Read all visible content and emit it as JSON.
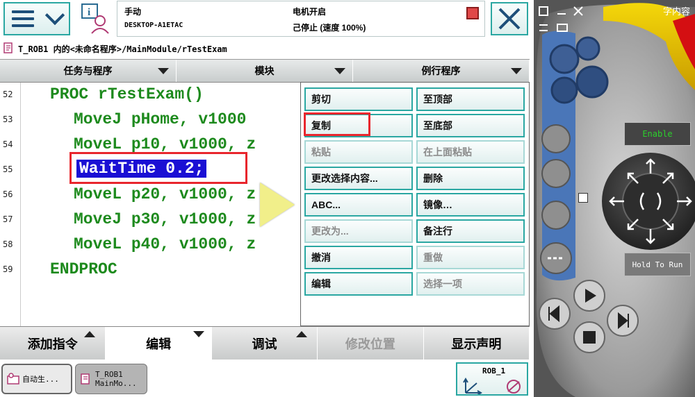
{
  "header": {
    "mode": "手动",
    "host": "DESKTOP-A1ETAC",
    "motor": "电机开启",
    "state": "己停止 (速度 100%)"
  },
  "path": "T_ROB1 内的<未命名程序>/MainModule/rTestExam",
  "tabs": [
    {
      "label": "任务与程序"
    },
    {
      "label": "模块"
    },
    {
      "label": "例行程序"
    }
  ],
  "editor": {
    "lines": [
      {
        "num": "52",
        "code": "PROC rTestExam()"
      },
      {
        "num": "53",
        "code": "MoveJ pHome, v1000"
      },
      {
        "num": "54",
        "code": "MoveL p10, v1000, z"
      },
      {
        "num": "55",
        "code": "WaitTime 0.2;"
      },
      {
        "num": "56",
        "code": "MoveL p20, v1000, z"
      },
      {
        "num": "57",
        "code": "MoveJ p30, v1000, z"
      },
      {
        "num": "58",
        "code": "MoveL p40, v1000, z"
      },
      {
        "num": "59",
        "code": "ENDPROC"
      }
    ]
  },
  "edit_menu": {
    "left": [
      {
        "label": "剪切",
        "enabled": true
      },
      {
        "label": "复制",
        "enabled": true
      },
      {
        "label": "粘贴",
        "enabled": false
      },
      {
        "label": "更改选择内容...",
        "enabled": true
      },
      {
        "label": "ABC...",
        "enabled": true
      },
      {
        "label": "更改为...",
        "enabled": false
      },
      {
        "label": "撤消",
        "enabled": true
      },
      {
        "label": "编辑",
        "enabled": true
      }
    ],
    "right": [
      {
        "label": "至顶部",
        "enabled": true
      },
      {
        "label": "至底部",
        "enabled": true
      },
      {
        "label": "在上面粘贴",
        "enabled": false
      },
      {
        "label": "删除",
        "enabled": true
      },
      {
        "label": "镜像…",
        "enabled": true
      },
      {
        "label": "备注行",
        "enabled": true
      },
      {
        "label": "重做",
        "enabled": false
      },
      {
        "label": "选择一项",
        "enabled": false
      }
    ]
  },
  "bottom_tabs": [
    {
      "label": "添加指令"
    },
    {
      "label": "编辑"
    },
    {
      "label": "调试"
    },
    {
      "label": "修改位置"
    },
    {
      "label": "显示声明"
    }
  ],
  "taskbar": {
    "task1": "自动生...",
    "task2_line1": "T_ROB1",
    "task2_line2": "MainMo...",
    "rob": "ROB_1"
  },
  "pendant": {
    "enable": "Enable",
    "hold": "Hold To Run",
    "top_text": "字内容"
  },
  "colors": {
    "accent": "#2aa7a2",
    "code": "#1d8a1d",
    "selection": "#1a0fd4",
    "highlight": "#e8262d"
  }
}
